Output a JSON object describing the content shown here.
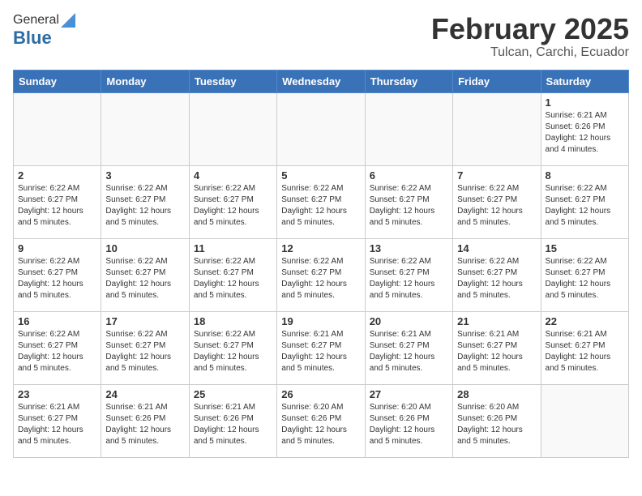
{
  "header": {
    "logo_general": "General",
    "logo_blue": "Blue",
    "month_title": "February 2025",
    "location": "Tulcan, Carchi, Ecuador"
  },
  "days_of_week": [
    "Sunday",
    "Monday",
    "Tuesday",
    "Wednesday",
    "Thursday",
    "Friday",
    "Saturday"
  ],
  "weeks": [
    [
      {
        "day": "",
        "info": ""
      },
      {
        "day": "",
        "info": ""
      },
      {
        "day": "",
        "info": ""
      },
      {
        "day": "",
        "info": ""
      },
      {
        "day": "",
        "info": ""
      },
      {
        "day": "",
        "info": ""
      },
      {
        "day": "1",
        "info": "Sunrise: 6:21 AM\nSunset: 6:26 PM\nDaylight: 12 hours and 4 minutes."
      }
    ],
    [
      {
        "day": "2",
        "info": "Sunrise: 6:22 AM\nSunset: 6:27 PM\nDaylight: 12 hours and 5 minutes."
      },
      {
        "day": "3",
        "info": "Sunrise: 6:22 AM\nSunset: 6:27 PM\nDaylight: 12 hours and 5 minutes."
      },
      {
        "day": "4",
        "info": "Sunrise: 6:22 AM\nSunset: 6:27 PM\nDaylight: 12 hours and 5 minutes."
      },
      {
        "day": "5",
        "info": "Sunrise: 6:22 AM\nSunset: 6:27 PM\nDaylight: 12 hours and 5 minutes."
      },
      {
        "day": "6",
        "info": "Sunrise: 6:22 AM\nSunset: 6:27 PM\nDaylight: 12 hours and 5 minutes."
      },
      {
        "day": "7",
        "info": "Sunrise: 6:22 AM\nSunset: 6:27 PM\nDaylight: 12 hours and 5 minutes."
      },
      {
        "day": "8",
        "info": "Sunrise: 6:22 AM\nSunset: 6:27 PM\nDaylight: 12 hours and 5 minutes."
      }
    ],
    [
      {
        "day": "9",
        "info": "Sunrise: 6:22 AM\nSunset: 6:27 PM\nDaylight: 12 hours and 5 minutes."
      },
      {
        "day": "10",
        "info": "Sunrise: 6:22 AM\nSunset: 6:27 PM\nDaylight: 12 hours and 5 minutes."
      },
      {
        "day": "11",
        "info": "Sunrise: 6:22 AM\nSunset: 6:27 PM\nDaylight: 12 hours and 5 minutes."
      },
      {
        "day": "12",
        "info": "Sunrise: 6:22 AM\nSunset: 6:27 PM\nDaylight: 12 hours and 5 minutes."
      },
      {
        "day": "13",
        "info": "Sunrise: 6:22 AM\nSunset: 6:27 PM\nDaylight: 12 hours and 5 minutes."
      },
      {
        "day": "14",
        "info": "Sunrise: 6:22 AM\nSunset: 6:27 PM\nDaylight: 12 hours and 5 minutes."
      },
      {
        "day": "15",
        "info": "Sunrise: 6:22 AM\nSunset: 6:27 PM\nDaylight: 12 hours and 5 minutes."
      }
    ],
    [
      {
        "day": "16",
        "info": "Sunrise: 6:22 AM\nSunset: 6:27 PM\nDaylight: 12 hours and 5 minutes."
      },
      {
        "day": "17",
        "info": "Sunrise: 6:22 AM\nSunset: 6:27 PM\nDaylight: 12 hours and 5 minutes."
      },
      {
        "day": "18",
        "info": "Sunrise: 6:22 AM\nSunset: 6:27 PM\nDaylight: 12 hours and 5 minutes."
      },
      {
        "day": "19",
        "info": "Sunrise: 6:21 AM\nSunset: 6:27 PM\nDaylight: 12 hours and 5 minutes."
      },
      {
        "day": "20",
        "info": "Sunrise: 6:21 AM\nSunset: 6:27 PM\nDaylight: 12 hours and 5 minutes."
      },
      {
        "day": "21",
        "info": "Sunrise: 6:21 AM\nSunset: 6:27 PM\nDaylight: 12 hours and 5 minutes."
      },
      {
        "day": "22",
        "info": "Sunrise: 6:21 AM\nSunset: 6:27 PM\nDaylight: 12 hours and 5 minutes."
      }
    ],
    [
      {
        "day": "23",
        "info": "Sunrise: 6:21 AM\nSunset: 6:27 PM\nDaylight: 12 hours and 5 minutes."
      },
      {
        "day": "24",
        "info": "Sunrise: 6:21 AM\nSunset: 6:26 PM\nDaylight: 12 hours and 5 minutes."
      },
      {
        "day": "25",
        "info": "Sunrise: 6:21 AM\nSunset: 6:26 PM\nDaylight: 12 hours and 5 minutes."
      },
      {
        "day": "26",
        "info": "Sunrise: 6:20 AM\nSunset: 6:26 PM\nDaylight: 12 hours and 5 minutes."
      },
      {
        "day": "27",
        "info": "Sunrise: 6:20 AM\nSunset: 6:26 PM\nDaylight: 12 hours and 5 minutes."
      },
      {
        "day": "28",
        "info": "Sunrise: 6:20 AM\nSunset: 6:26 PM\nDaylight: 12 hours and 5 minutes."
      },
      {
        "day": "",
        "info": ""
      }
    ]
  ]
}
